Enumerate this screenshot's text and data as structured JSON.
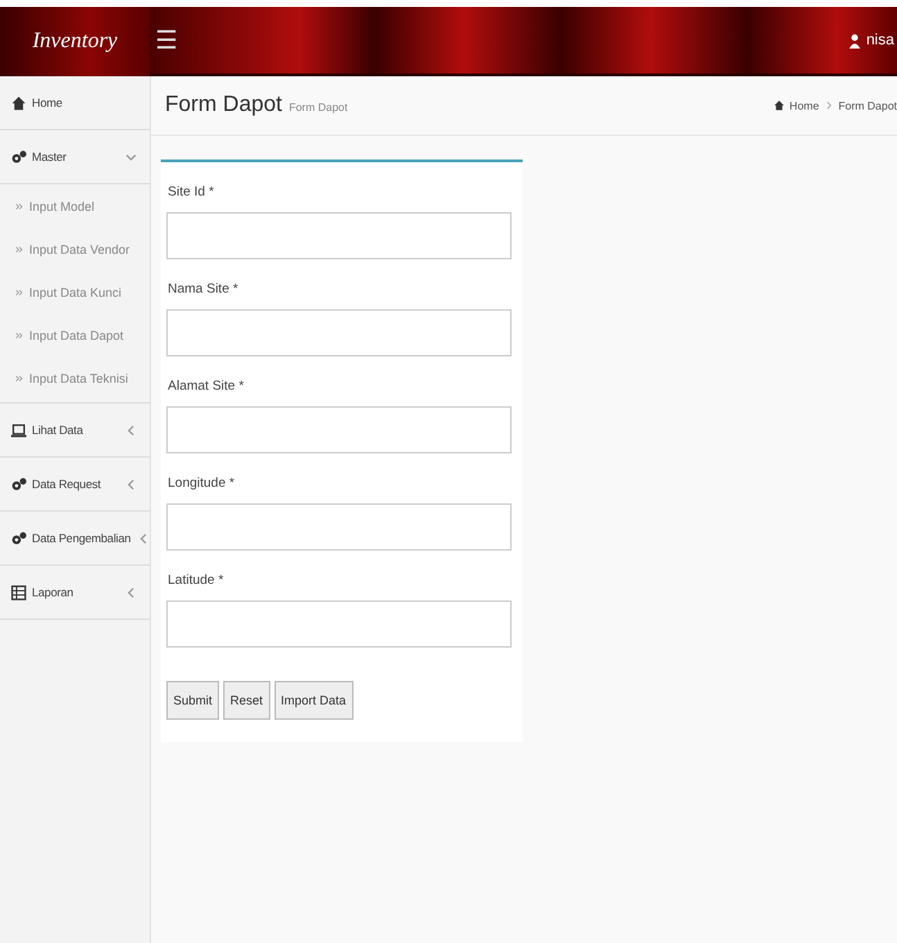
{
  "header": {
    "logo": "Inventory",
    "menu_glyph": "☰",
    "user": "nisa"
  },
  "sidebar": {
    "items": [
      {
        "label": "Home",
        "selected": false
      },
      {
        "label": "Master",
        "expanded": true,
        "selected": false,
        "children": [
          {
            "label": "Input Model",
            "selected": false
          },
          {
            "label": "Input Data Vendor",
            "selected": false
          },
          {
            "label": "Input Data Kunci",
            "selected": false
          },
          {
            "label": "Input Data Dapot",
            "selected": false
          },
          {
            "label": "Input Data Teknisi",
            "selected": false
          }
        ]
      },
      {
        "label": "Lihat Data",
        "expanded": false,
        "selected": false
      },
      {
        "label": "Data Request",
        "expanded": false,
        "selected": false
      },
      {
        "label": "Data Pengembalian",
        "expanded": false,
        "selected": false
      },
      {
        "label": "Laporan",
        "expanded": false,
        "selected": false
      }
    ]
  },
  "page": {
    "title": "Form Dapot",
    "subtitle": "Form Dapot",
    "breadcrumb": [
      "Home",
      "Form Dapot"
    ]
  },
  "form": {
    "fields": [
      {
        "label": "Site Id *"
      },
      {
        "label": "Nama Site *"
      },
      {
        "label": "Alamat Site *"
      },
      {
        "label": "Longitude *"
      },
      {
        "label": "Latitude *"
      }
    ],
    "buttons": [
      "Submit",
      "Reset",
      "Import Data"
    ]
  }
}
